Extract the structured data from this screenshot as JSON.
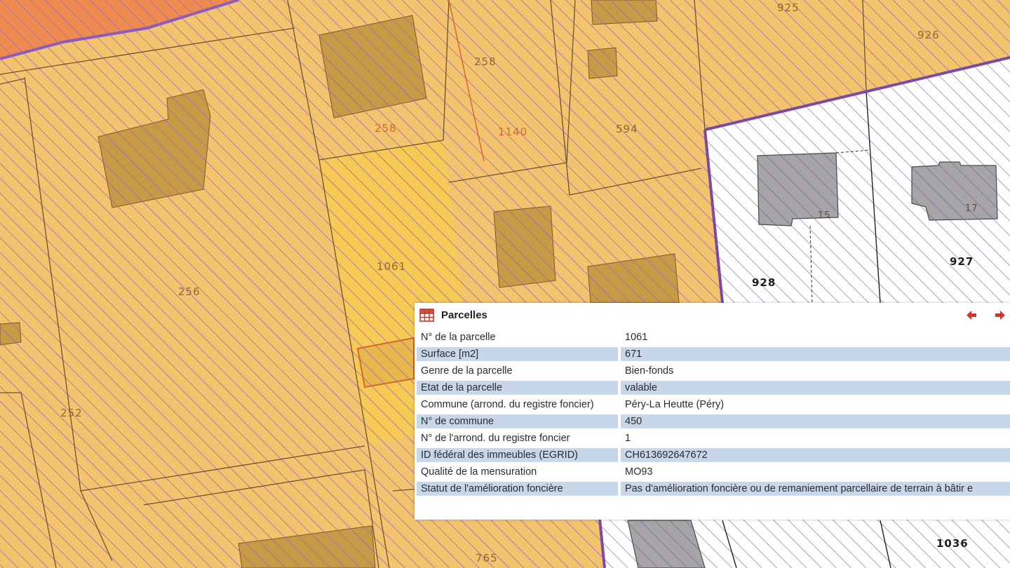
{
  "map": {
    "parcel_labels": [
      "258",
      "258",
      "1140",
      "594",
      "925",
      "926",
      "256",
      "1061",
      "252",
      "765",
      "928",
      "927",
      "1036"
    ],
    "house_numbers": [
      "15",
      "17"
    ],
    "colors": {
      "zone": "#f3c36e",
      "hatch": "#9a6ab0",
      "boundary": "#7b4aa8",
      "building": "#c79a45",
      "building_gray": "#a7a4a8",
      "selected": "#f6ca55"
    }
  },
  "panel": {
    "title": "Parcelles",
    "icon": "grid-table-icon",
    "prev_icon": "arrow-left-icon",
    "next_icon": "arrow-right-icon",
    "rows": [
      {
        "label": "N° de la parcelle",
        "value": "1061"
      },
      {
        "label": "Surface [m2]",
        "value": "671"
      },
      {
        "label": "Genre de la parcelle",
        "value": "Bien-fonds"
      },
      {
        "label": "Etat de la parcelle",
        "value": "valable"
      },
      {
        "label": "Commune (arrond. du registre foncier)",
        "value": "Péry-La Heutte (Péry)"
      },
      {
        "label": "N° de commune",
        "value": "450"
      },
      {
        "label": "N° de l'arrond. du registre foncier",
        "value": "1"
      },
      {
        "label": "ID fédéral des immeubles (EGRID)",
        "value": "CH613692647672"
      },
      {
        "label": "Qualité de la mensuration",
        "value": "MO93"
      },
      {
        "label": "Statut de l'amélioration foncière",
        "value": "Pas d'amélioration foncière ou de remaniement parcellaire de terrain à bâtir e"
      }
    ]
  }
}
